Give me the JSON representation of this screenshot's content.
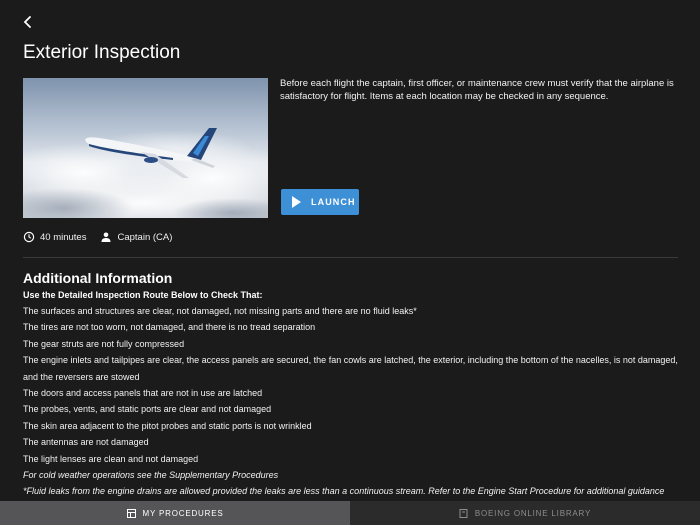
{
  "header": {
    "back_icon": "chevron-left-icon",
    "title": "Exterior Inspection"
  },
  "hero": {
    "image": "airplane-in-clouds",
    "description": "Before each flight the captain, first officer, or maintenance crew must verify that the airplane is satisfactory for flight. Items at each location may be checked in any sequence."
  },
  "launch": {
    "icon": "play-icon",
    "label": "LAUNCH",
    "color": "#3d8fd6"
  },
  "meta": {
    "duration_icon": "clock-icon",
    "duration": "40 minutes",
    "role_icon": "person-icon",
    "role": "Captain (CA)"
  },
  "additional": {
    "title": "Additional Information",
    "subtitle": "Use the Detailed Inspection Route Below to Check That:",
    "items": [
      "The surfaces and structures are clear, not damaged, not missing parts and there are no fluid leaks*",
      "The tires are not too worn, not damaged, and there is no tread separation",
      "The gear struts are not fully compressed",
      "The engine inlets and tailpipes are clear, the access panels are secured, the fan cowls are latched, the exterior, including the bottom of the nacelles, is not damaged, and the reversers are stowed",
      "The doors and access panels that are not in use are latched",
      "The probes, vents, and static ports are clear and not damaged",
      "The skin area adjacent to the pitot probes and static ports is not wrinkled",
      "The antennas are not damaged",
      "The light lenses are clean and not damaged"
    ],
    "notes": [
      "For cold weather operations see the Supplementary Procedures",
      "*Fluid leaks from the engine drains are allowed provided the leaks are less than a continuous stream. Refer to the Engine Start Procedure for additional guidance"
    ]
  },
  "tabs": [
    {
      "label": "MY PROCEDURES",
      "icon": "grid-icon",
      "active": true
    },
    {
      "label": "BOEING ONLINE LIBRARY",
      "icon": "book-icon",
      "active": false
    }
  ]
}
